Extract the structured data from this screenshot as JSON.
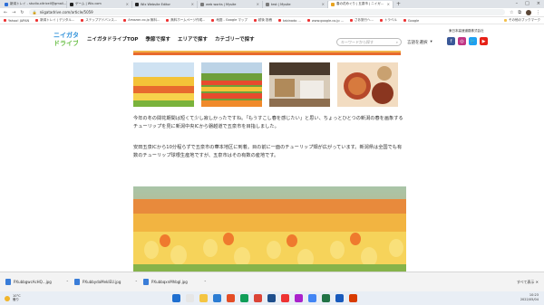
{
  "browser": {
    "tabs": [
      {
        "label": "新潟トレイ - studio.xitricell@gmail...",
        "color": "#2d6fd8",
        "active": false
      },
      {
        "label": "ゲーム | Wix.com",
        "color": "#222",
        "active": false
      },
      {
        "label": "Wix Website Editor",
        "color": "#222",
        "active": false
      },
      {
        "label": "web works | Mysite",
        "color": "#7a7a7a",
        "active": false
      },
      {
        "label": "test | Mysite",
        "color": "#7a7a7a",
        "active": false
      },
      {
        "label": "春の花めぐり | 五泉市 | ニイガ...",
        "color": "#e8a321",
        "active": true
      }
    ],
    "url": "niigatadrive.com/article/5059",
    "bookmarks": [
      "Yahoo! JAPAN",
      "新潟トレイ | デジタル...",
      "ステップアドバンス...",
      "Amazon.co.jp 無料...",
      "無料ホームページ作成...",
      "地図 - Google マップ",
      "越後 投稿",
      "tabinado ...",
      "www.google.co.jp ...",
      "さあ旅行へ...",
      "トラベル",
      "Google",
      "その他のブックマーク"
    ]
  },
  "site": {
    "logo_lines": [
      "ニイガタ",
      "ドライブ"
    ],
    "nav": [
      "ニイガタドライブTOP",
      "季節で探す",
      "エリアで探す",
      "カテゴリーで探す"
    ],
    "search": {
      "placeholder": "キーワードから探す"
    },
    "lang": {
      "label": "言語を選択",
      "arrow": "▾"
    },
    "expressway": "東日本高速道路株式会社",
    "social": [
      {
        "icon": "f",
        "color": "#3b5998"
      },
      {
        "icon": "◎",
        "color": "#c13584"
      },
      {
        "icon": "🐦",
        "color": "#1da1f2"
      },
      {
        "icon": "▶",
        "color": "#e62117"
      }
    ],
    "para1": "今年の冬の間花期間は短くて少し寂しかったですね。「もうすこし春を感じたい」と思い、ちょっとひとつの新潟の春を画象するチューリップを見に新潟中央ICから磐越道で五泉市を目指しました。",
    "para2": "安田五泉ICから10分程らずで五泉市の華本地区に到着。目の前に一面のチューリップ畑が広がっています。新潟県は全国でも有数のチューリップ球根生産地ですが、五泉市はその有数の産地です。"
  },
  "downloads": {
    "items": [
      "PXubbgwcAcHQ...jpg",
      "PXubbydaMeklEU.jpg",
      "PXubbqxnMhbgl.jpg"
    ],
    "chevron": "⌃",
    "show_all": "すべて表示 ✕"
  },
  "taskbar": {
    "weather": "10°C\n曇り",
    "time": "10:23",
    "date": "2022/05/04",
    "icon_colors": [
      "#1f6fd0",
      "#e6e6e6",
      "#f4c542",
      "#2b7cd3",
      "#e44d26",
      "#0f9d58",
      "#db4437",
      "#1e4e8c",
      "#e33",
      "#a2c",
      "#4285f4",
      "#217346",
      "#185abd",
      "#d83b01"
    ]
  }
}
